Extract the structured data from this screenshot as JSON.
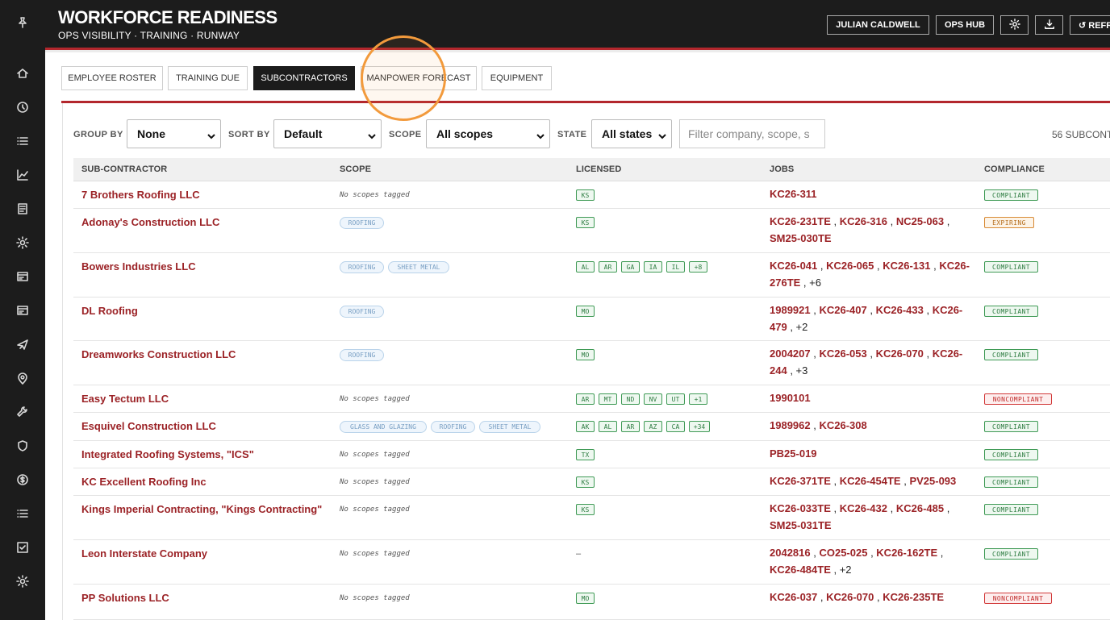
{
  "app": {
    "title": "WORKFORCE READINESS",
    "subtitle": "OPS VISIBILITY · TRAINING · RUNWAY"
  },
  "header": {
    "user_label": "JULIAN CALDWELL",
    "hub_label": "OPS HUB",
    "refresh_label": "↺ REFR",
    "settings_icon": "gear-icon",
    "download_icon": "download-icon"
  },
  "sidebar": {
    "icons": [
      "pin-icon",
      "home-icon",
      "clock-icon",
      "list-icon",
      "chart-icon",
      "document-icon",
      "gear-icon",
      "card-icon",
      "card-icon",
      "megaphone-icon",
      "location-icon",
      "wrench-icon",
      "shield-icon",
      "dollar-icon",
      "list-icon",
      "checkbox-icon",
      "gear-icon"
    ]
  },
  "tabs": [
    {
      "label": "EMPLOYEE ROSTER",
      "active": false
    },
    {
      "label": "TRAINING DUE",
      "active": false
    },
    {
      "label": "SUBCONTRACTORS",
      "active": true
    },
    {
      "label": "MANPOWER FORECAST",
      "active": false
    },
    {
      "label": "EQUIPMENT",
      "active": false
    }
  ],
  "filters": {
    "group_by": {
      "label": "GROUP BY",
      "value": "None"
    },
    "sort_by": {
      "label": "SORT BY",
      "value": "Default"
    },
    "scope": {
      "label": "SCOPE",
      "value": "All scopes"
    },
    "state": {
      "label": "STATE",
      "value": "All states"
    },
    "search_placeholder": "Filter company, scope, s",
    "count_text": "56 SUBCONT"
  },
  "table": {
    "columns": [
      "SUB-CONTRACTOR",
      "SCOPE",
      "LICENSED",
      "JOBS",
      "COMPLIANCE"
    ],
    "no_scope_text": "No scopes tagged",
    "rows": [
      {
        "name": "7 Brothers Roofing LLC",
        "scopes": [],
        "licensed": [
          "KS"
        ],
        "jobs": [
          "KC26-311"
        ],
        "more": "",
        "compliance": "COMPLIANT"
      },
      {
        "name": "Adonay's Construction LLC",
        "scopes": [
          "ROOFING"
        ],
        "licensed": [
          "KS"
        ],
        "jobs": [
          "KC26-231TE",
          "KC26-316",
          "NC25-063",
          "SM25-030TE"
        ],
        "more": "",
        "compliance": "EXPIRING"
      },
      {
        "name": "Bowers Industries LLC",
        "scopes": [
          "ROOFING",
          "SHEET METAL"
        ],
        "licensed": [
          "AL",
          "AR",
          "GA",
          "IA",
          "IL",
          "+8"
        ],
        "jobs": [
          "KC26-041",
          "KC26-065",
          "KC26-131",
          "KC26-276TE"
        ],
        "more": "+6",
        "compliance": "COMPLIANT"
      },
      {
        "name": "DL Roofing",
        "scopes": [
          "ROOFING"
        ],
        "licensed": [
          "MO"
        ],
        "jobs": [
          "1989921",
          "KC26-407",
          "KC26-433",
          "KC26-479"
        ],
        "more": "+2",
        "compliance": "COMPLIANT"
      },
      {
        "name": "Dreamworks Construction LLC",
        "scopes": [
          "ROOFING"
        ],
        "licensed": [
          "MO"
        ],
        "jobs": [
          "2004207",
          "KC26-053",
          "KC26-070",
          "KC26-244"
        ],
        "more": "+3",
        "compliance": "COMPLIANT"
      },
      {
        "name": "Easy Tectum LLC",
        "scopes": [],
        "licensed": [
          "AR",
          "MT",
          "ND",
          "NV",
          "UT",
          "+1"
        ],
        "jobs": [
          "1990101"
        ],
        "more": "",
        "compliance": "NONCOMPLIANT"
      },
      {
        "name": "Esquivel Construction LLC",
        "scopes": [
          "GLASS AND GLAZING",
          "ROOFING",
          "SHEET METAL"
        ],
        "licensed": [
          "AK",
          "AL",
          "AR",
          "AZ",
          "CA",
          "+34"
        ],
        "jobs": [
          "1989962",
          "KC26-308"
        ],
        "more": "",
        "compliance": "COMPLIANT"
      },
      {
        "name": "Integrated Roofing Systems, \"ICS\"",
        "scopes": [],
        "licensed": [
          "TX"
        ],
        "jobs": [
          "PB25-019"
        ],
        "more": "",
        "compliance": "COMPLIANT"
      },
      {
        "name": "KC Excellent Roofing Inc",
        "scopes": [],
        "licensed": [
          "KS"
        ],
        "jobs": [
          "KC26-371TE",
          "KC26-454TE",
          "PV25-093"
        ],
        "more": "",
        "compliance": "COMPLIANT"
      },
      {
        "name": "Kings Imperial Contracting, \"Kings Contracting\"",
        "scopes": [],
        "licensed": [
          "KS"
        ],
        "jobs": [
          "KC26-033TE",
          "KC26-432",
          "KC26-485",
          "SM25-031TE"
        ],
        "more": "",
        "compliance": "COMPLIANT"
      },
      {
        "name": "Leon Interstate Company",
        "scopes": [],
        "licensed": [],
        "licensed_empty": "–",
        "jobs": [
          "2042816",
          "CO25-025",
          "KC26-162TE",
          "KC26-484TE"
        ],
        "more": "+2",
        "compliance": "COMPLIANT"
      },
      {
        "name": "PP Solutions LLC",
        "scopes": [],
        "licensed": [
          "MO"
        ],
        "jobs": [
          "KC26-037",
          "KC26-070",
          "KC26-235TE"
        ],
        "more": "",
        "compliance": "NONCOMPLIANT"
      }
    ]
  },
  "colors": {
    "accent": "#b3272d",
    "dark": "#1c1c1c",
    "company_link": "#9b2226",
    "annotation_circle": "#f29a3c"
  }
}
